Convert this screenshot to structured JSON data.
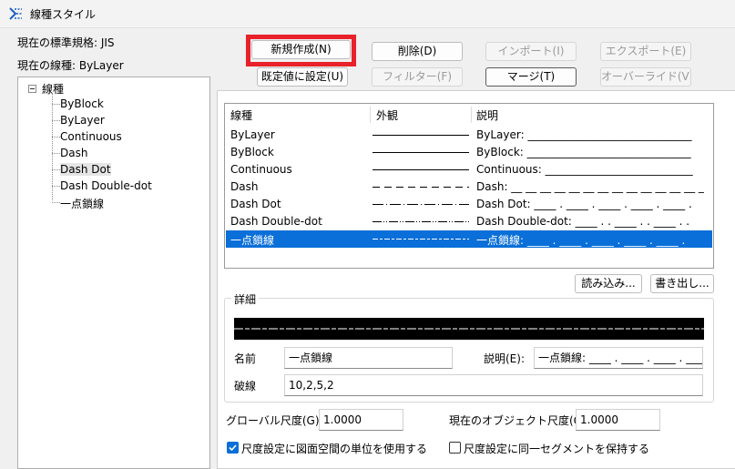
{
  "window": {
    "title": "線種スタイル"
  },
  "info": {
    "standard": "現在の標準規格: JIS",
    "current_linetype": "現在の線種: ByLayer"
  },
  "buttons": {
    "new": "新規作成(N)",
    "delete": "削除(D)",
    "import": "インポート(I)",
    "export": "エクスポート(E)",
    "set_default": "既定値に設定(U)",
    "filter": "フィルター(F)",
    "merge": "マージ(T)",
    "override": "オーバーライド(V)",
    "load": "読み込み...",
    "save": "書き出し..."
  },
  "tree": {
    "root": "線種",
    "items": [
      "ByBlock",
      "ByLayer",
      "Continuous",
      "Dash",
      "Dash Dot",
      "Dash Double-dot",
      "一点鎖線"
    ]
  },
  "list": {
    "columns": [
      "線種",
      "外観",
      "説明"
    ],
    "rows": [
      {
        "name": "ByLayer",
        "desc": "ByLayer: ______________________________"
      },
      {
        "name": "ByBlock",
        "desc": "ByBlock: ______________________________"
      },
      {
        "name": "Continuous",
        "desc": "Continuous: ___________________________"
      },
      {
        "name": "Dash",
        "desc": "Dash: __ __ __ __ __ __ __ __ __ __ __ __ __ _"
      },
      {
        "name": "Dash Dot",
        "desc": "Dash Dot: ____ . ____ . ____ . ____ . ____ ."
      },
      {
        "name": "Dash Double-dot",
        "desc": "Dash Double-dot: ____ . . ____ . . ____ . ."
      },
      {
        "name": "一点鎖線",
        "desc": "一点鎖線: ____ . ____ . ____ . ____ . ____ ."
      }
    ],
    "selected_index": 6
  },
  "detail": {
    "title": "詳細",
    "name_label": "名前",
    "name_value": "一点鎖線",
    "desc_label": "説明(E):",
    "desc_value": "一点鎖線: ____ . ____ . ____ . ____ . .",
    "pattern_label": "破線",
    "pattern_value": "10,2,5,2"
  },
  "scale": {
    "global_label": "グローバル尺度(G):",
    "global_value": "1.0000",
    "object_label": "現在のオブジェクト尺度(O):",
    "object_value": "1.0000"
  },
  "options": {
    "paperspace_label": "尺度設定に図面空間の単位を使用する",
    "paperspace_checked": true,
    "segment_label": "尺度設定に同一セグメントを保持する",
    "segment_checked": false
  },
  "colors": {
    "accent": "#0a6fd8",
    "highlight": "#e8212a"
  }
}
